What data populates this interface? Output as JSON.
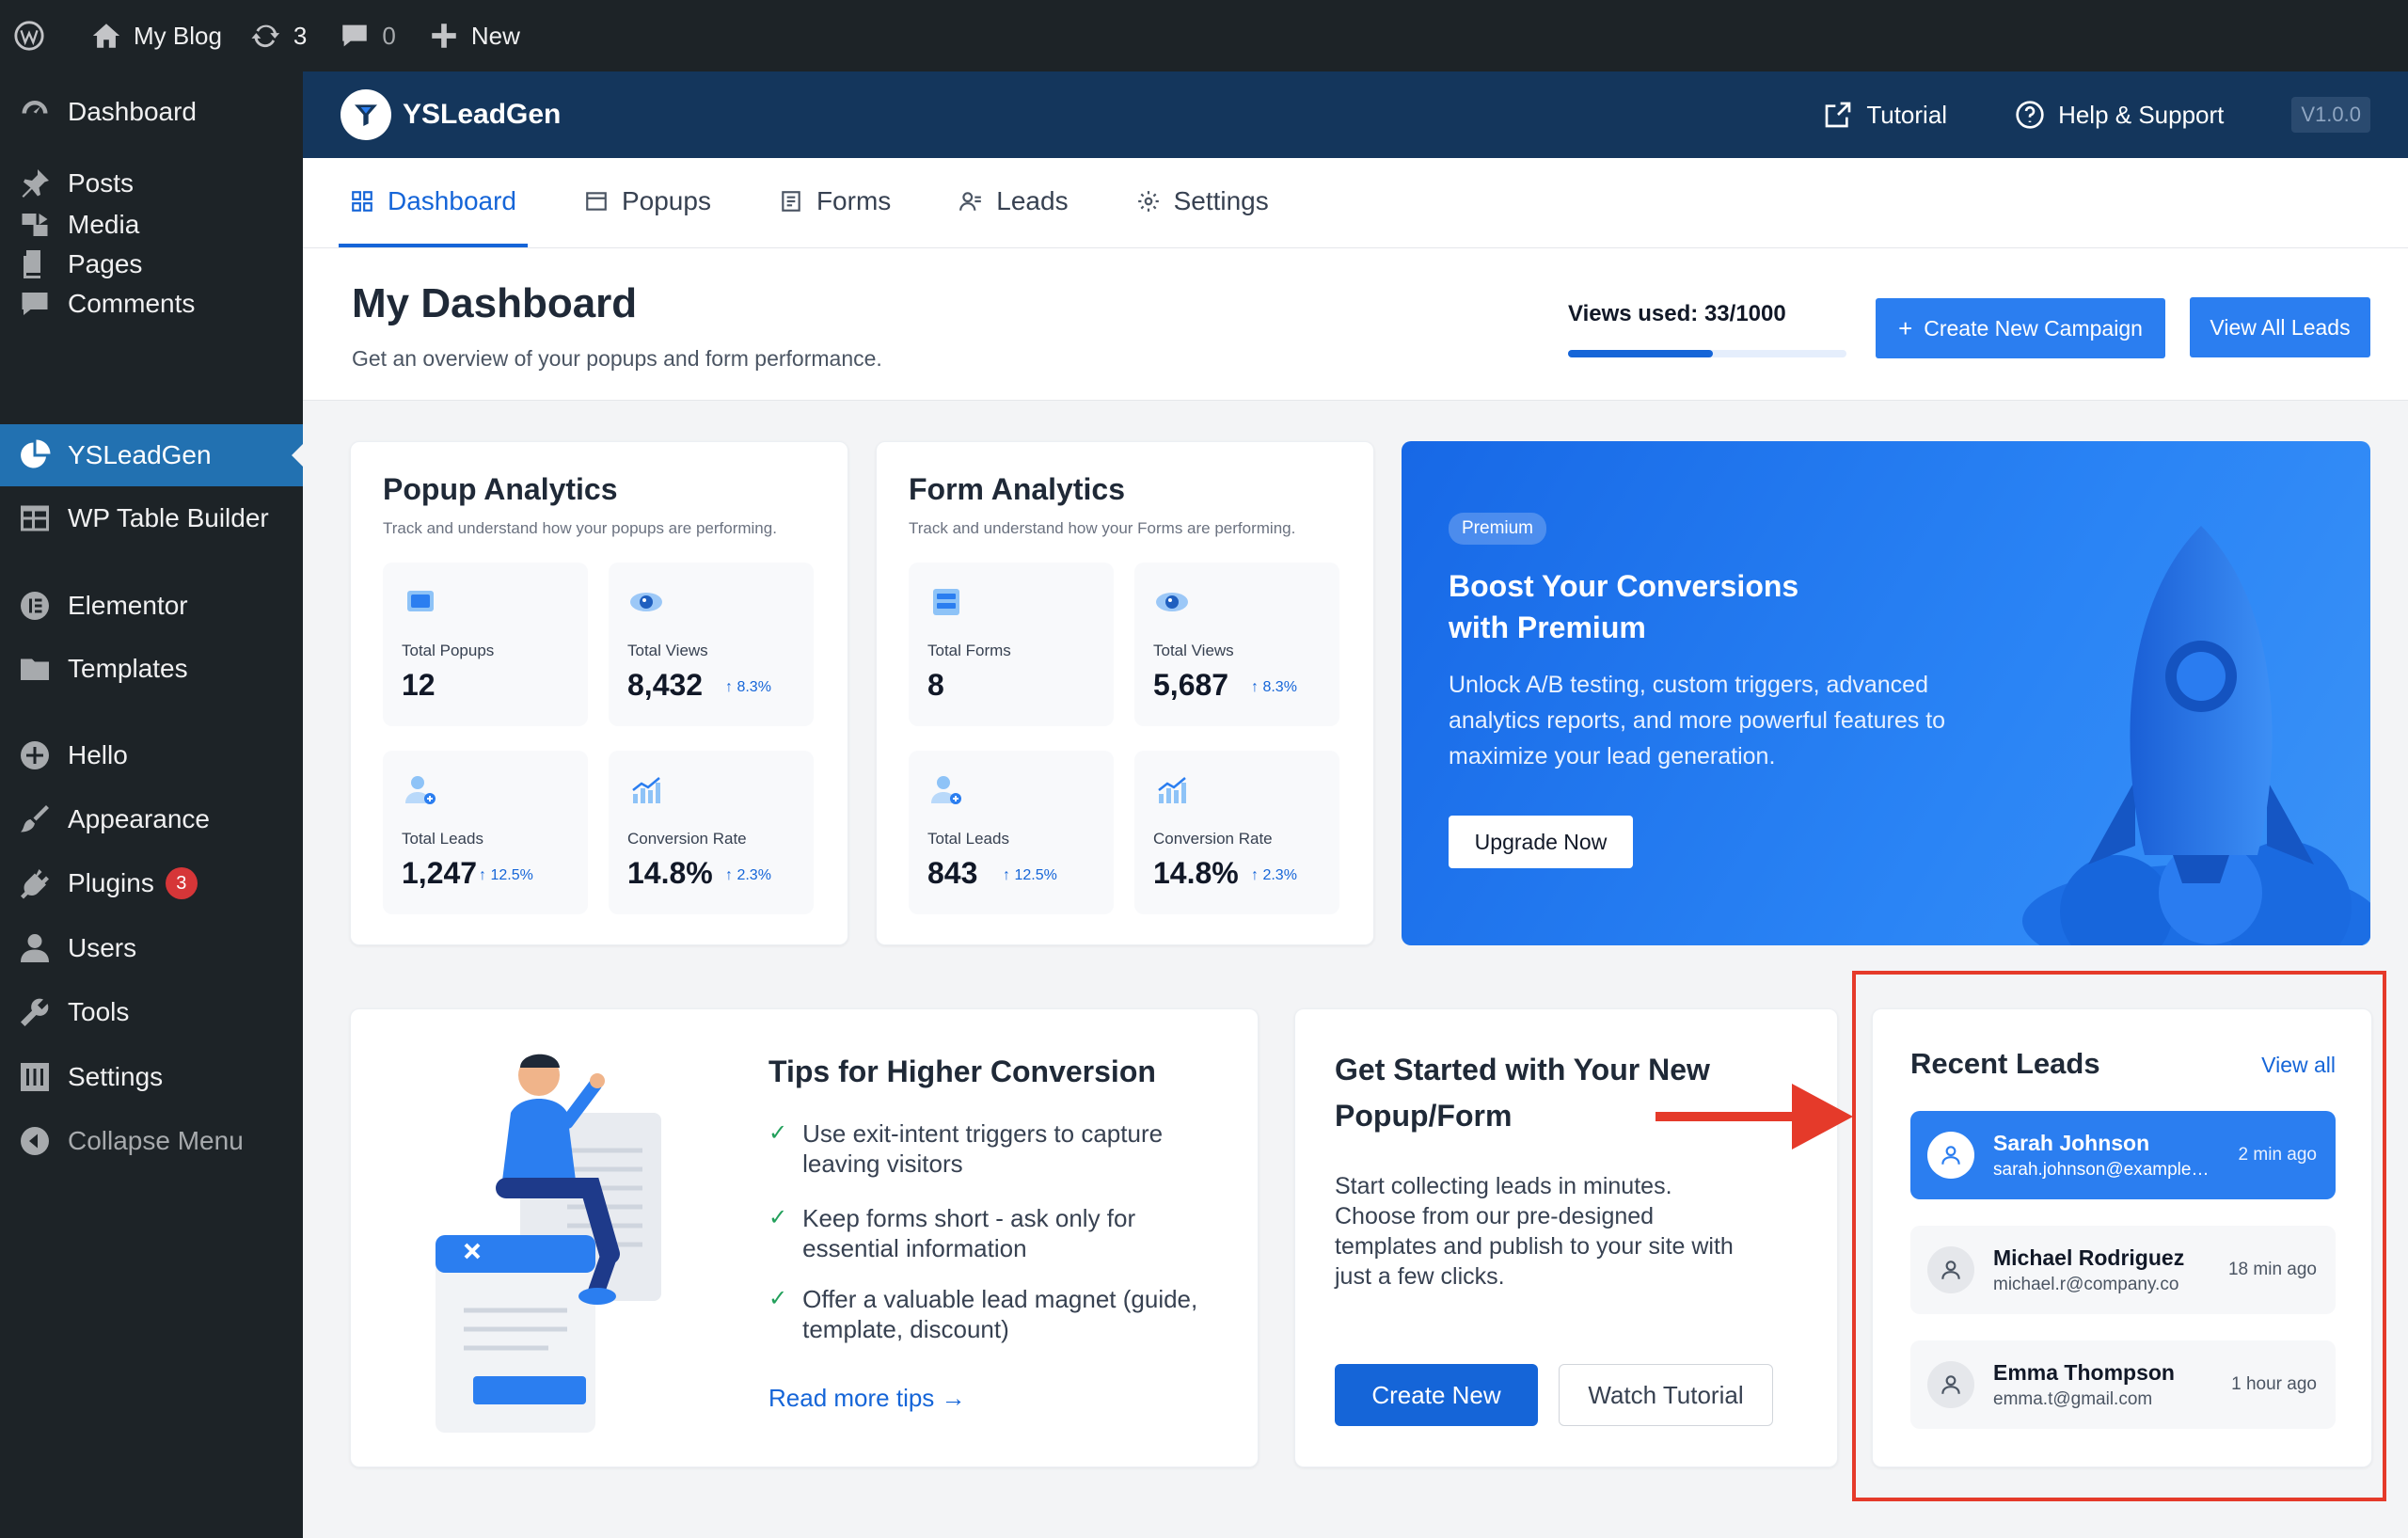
{
  "admin_bar": {
    "site": "My Blog",
    "updates": "3",
    "comments": "0",
    "new": "New"
  },
  "sidebar": {
    "items": [
      {
        "label": "Dashboard"
      },
      {
        "label": "Posts"
      },
      {
        "label": "Media"
      },
      {
        "label": "Pages"
      },
      {
        "label": "Comments"
      },
      {
        "label": "YSLeadGen"
      },
      {
        "label": "WP Table Builder"
      },
      {
        "label": "Elementor"
      },
      {
        "label": "Templates"
      },
      {
        "label": "Hello"
      },
      {
        "label": "Appearance"
      },
      {
        "label": "Plugins",
        "badge": "3"
      },
      {
        "label": "Users"
      },
      {
        "label": "Tools"
      },
      {
        "label": "Settings"
      },
      {
        "label": "Collapse Menu"
      }
    ]
  },
  "header": {
    "brand": "YSLeadGen",
    "tutorial": "Tutorial",
    "help": "Help & Support",
    "version": "V1.0.0"
  },
  "tabs": [
    {
      "label": "Dashboard"
    },
    {
      "label": "Popups"
    },
    {
      "label": "Forms"
    },
    {
      "label": "Leads"
    },
    {
      "label": "Settings"
    }
  ],
  "page": {
    "title": "My Dashboard",
    "subtitle": "Get an overview of your popups and form performance.",
    "views_used_label": "Views used: 33/1000",
    "views_used_fraction": 0.52,
    "create_campaign": "Create New Campaign",
    "view_all_leads": "View All Leads"
  },
  "popup_analytics": {
    "title": "Popup Analytics",
    "subtitle": "Track and understand how your popups are performing.",
    "stats": [
      {
        "label": "Total Popups",
        "value": "12",
        "delta": ""
      },
      {
        "label": "Total Views",
        "value": "8,432",
        "delta": "↑ 8.3%"
      },
      {
        "label": "Total Leads",
        "value": "1,247",
        "delta": "↑ 12.5%"
      },
      {
        "label": "Conversion Rate",
        "value": "14.8%",
        "delta": "↑ 2.3%"
      }
    ]
  },
  "form_analytics": {
    "title": "Form Analytics",
    "subtitle": "Track and understand how your Forms are performing.",
    "stats": [
      {
        "label": "Total Forms",
        "value": "8",
        "delta": ""
      },
      {
        "label": "Total Views",
        "value": "5,687",
        "delta": "↑ 8.3%"
      },
      {
        "label": "Total Leads",
        "value": "843",
        "delta": "↑ 12.5%"
      },
      {
        "label": "Conversion Rate",
        "value": "14.8%",
        "delta": "↑ 2.3%"
      }
    ]
  },
  "premium": {
    "badge": "Premium",
    "title": "Boost Your Conversions with Premium",
    "description": "Unlock A/B testing, custom triggers, advanced analytics reports, and more powerful features to maximize your lead generation.",
    "button": "Upgrade Now"
  },
  "tips": {
    "title": "Tips for Higher Conversion",
    "items": [
      "Use exit-intent triggers to capture leaving visitors",
      "Keep forms short - ask only for essential information",
      "Offer a valuable lead magnet (guide, template, discount)"
    ],
    "link": "Read more tips →"
  },
  "get_started": {
    "title": "Get Started with Your New Popup/Form",
    "description": "Start collecting leads in minutes. Choose from our pre-designed templates and publish to your site with just a few clicks.",
    "create": "Create New",
    "watch": "Watch Tutorial"
  },
  "recent_leads": {
    "title": "Recent Leads",
    "view_all": "View all",
    "leads": [
      {
        "name": "Sarah Johnson",
        "email": "sarah.johnson@example....",
        "time": "2 min ago"
      },
      {
        "name": "Michael Rodriguez",
        "email": "michael.r@company.co",
        "time": "18 min ago"
      },
      {
        "name": "Emma Thompson",
        "email": "emma.t@gmail.com",
        "time": "1 hour ago"
      }
    ]
  },
  "colors": {
    "primary": "#1565d8",
    "header_bg": "#14365c",
    "admin_bg": "#1d2327",
    "highlight_red": "#e53a2a"
  }
}
